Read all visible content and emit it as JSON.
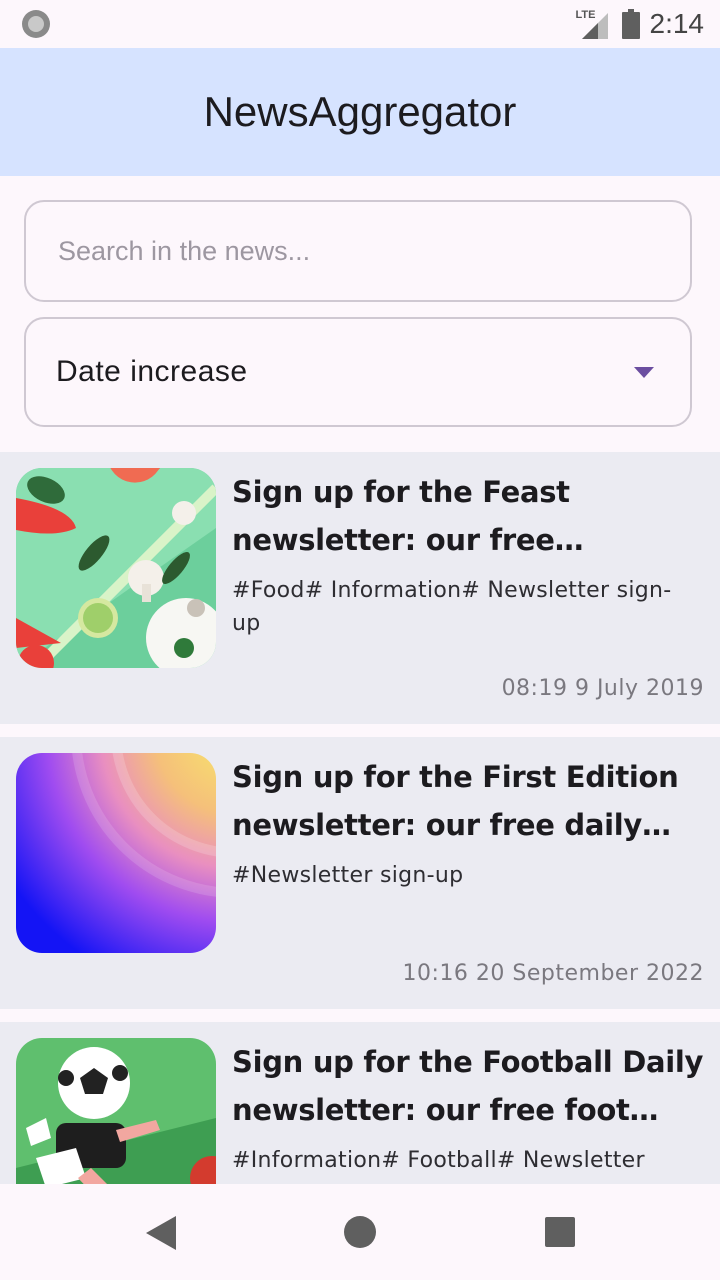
{
  "status_bar": {
    "network": "LTE",
    "time": "2:14"
  },
  "app_bar": {
    "title": "NewsAggregator"
  },
  "search": {
    "placeholder": "Search in the news...",
    "value": ""
  },
  "sort": {
    "selected": "Date increase"
  },
  "news": [
    {
      "title": "Sign up for the Feast newsletter: our free Guardian food email",
      "tags": "#Food# Information# Newsletter sign-up",
      "date": "08:19 9 July 2019",
      "image": "food-illustration"
    },
    {
      "title": "Sign up for the First Edition newsletter: our free daily news…",
      "tags": "#Newsletter sign-up",
      "date": "10:16 20 September 2022",
      "image": "gradient-illustration"
    },
    {
      "title": "Sign up for the Football Daily newsletter: our free foot…",
      "tags": "#Information# Football# Newsletter",
      "date": "",
      "image": "football-illustration"
    }
  ],
  "icons": {
    "status_left": "circle-icon",
    "signal": "lte-signal-icon",
    "battery": "battery-icon",
    "sort_caret": "dropdown-caret-icon",
    "nav_back": "back-triangle-icon",
    "nav_home": "home-circle-icon",
    "nav_recent": "recent-apps-square-icon"
  },
  "colors": {
    "app_bar": "#d6e3ff",
    "card_bg": "#ebebf2",
    "accent": "#6b4ea0"
  }
}
